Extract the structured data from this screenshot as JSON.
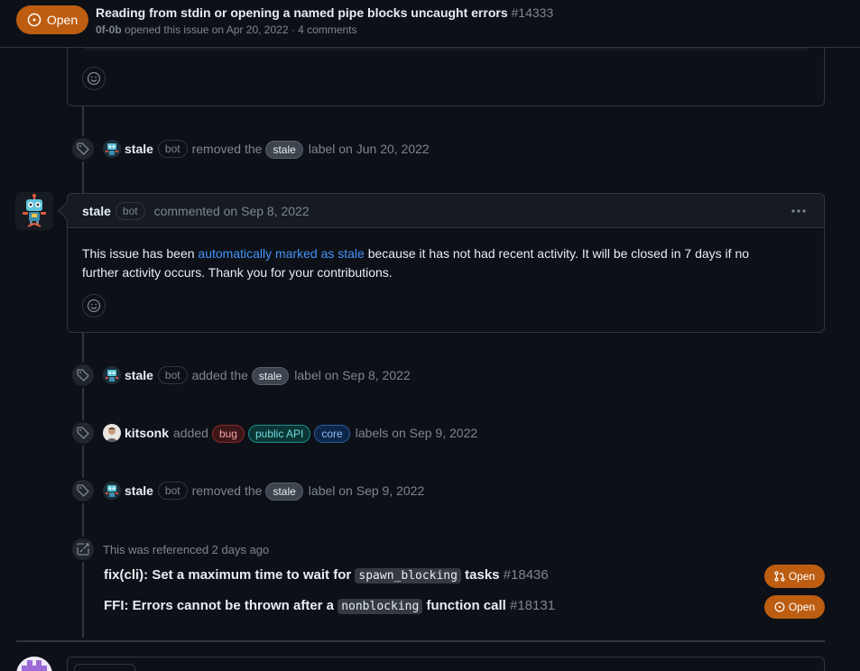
{
  "header": {
    "state": "Open",
    "title": "Reading from stdin or opening a named pipe blocks uncaught errors",
    "number": "#14333",
    "author": "0f-0b",
    "meta": "opened this issue on Apr 20, 2022 · 4 comments"
  },
  "events": [
    {
      "actor": "stale",
      "bot": "bot",
      "verb": "removed the",
      "labels": [
        "stale"
      ],
      "suffix": "label on Jun 20, 2022"
    },
    {
      "actor": "stale",
      "bot": "bot",
      "verb": "added the",
      "labels": [
        "stale"
      ],
      "suffix": "label on Sep 8, 2022"
    },
    {
      "actor": "kitsonk",
      "verb": "added",
      "labels": [
        "bug",
        "public API",
        "core"
      ],
      "suffix": "labels on Sep 9, 2022"
    },
    {
      "actor": "stale",
      "bot": "bot",
      "verb": "removed the",
      "labels": [
        "stale"
      ],
      "suffix": "label on Sep 9, 2022"
    }
  ],
  "comment": {
    "author": "stale",
    "bot": "bot",
    "meta": "commented on Sep 8, 2022",
    "body_pre": "This issue has been ",
    "body_link": "automatically marked as stale",
    "body_post": " because it has not had recent activity. It will be closed in 7 days if no further activity occurs. Thank you for your contributions."
  },
  "references": {
    "heading": "This was referenced 2 days ago",
    "items": [
      {
        "pre": "fix(cli): Set a maximum time to wait for ",
        "code": "spawn_blocking",
        "post": " tasks ",
        "number": "#18436",
        "state": "Open"
      },
      {
        "pre": "FFI: Errors cannot be thrown after a ",
        "code": "nonblocking",
        "post": " function call ",
        "number": "#18131",
        "state": "Open"
      }
    ]
  },
  "colors": {
    "background": "#0d1117",
    "border": "#30363d",
    "open_state": "#bd5d11",
    "link": "#4493f8"
  },
  "icons": [
    "issue-opened-icon",
    "tag-icon",
    "smiley-icon",
    "kebab-horizontal-icon",
    "cross-reference-icon",
    "git-pull-request-icon"
  ]
}
